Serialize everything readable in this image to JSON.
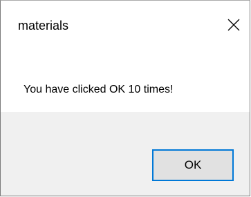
{
  "window": {
    "title": "materials",
    "close_icon": "close-icon"
  },
  "dialog": {
    "message": "You have clicked OK 10 times!",
    "ok_label": "OK"
  },
  "colors": {
    "footer_background": "#f0f0f0",
    "button_background": "#e1e1e1",
    "focus_border": "#0078d7"
  }
}
